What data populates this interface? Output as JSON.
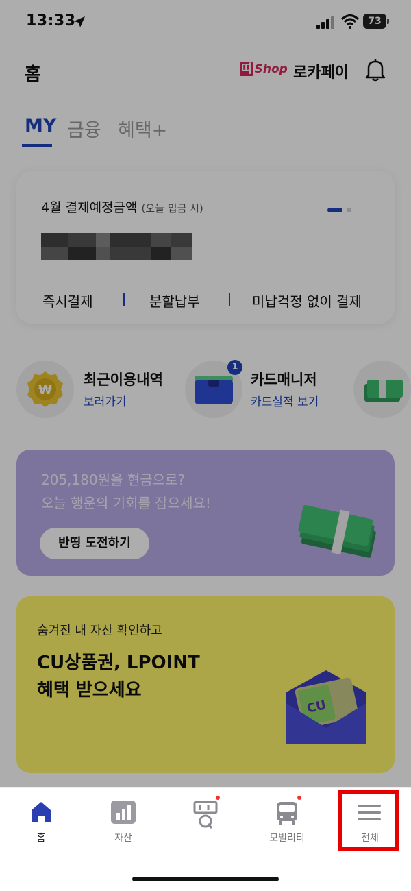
{
  "status_bar": {
    "time": "13:33",
    "battery": "73"
  },
  "header": {
    "title": "홈",
    "shop_logo_mark": "띠",
    "shop_logo_text": "Shop",
    "locapay": "로카페이"
  },
  "tabs": [
    {
      "label": "MY"
    },
    {
      "label": "금융"
    },
    {
      "label": "혜택+"
    }
  ],
  "payment_card": {
    "title": "4월 결제예정금액",
    "subtitle": "(오늘 입금 시)",
    "actions": [
      "즉시결제",
      "분할납부",
      "미납걱정 없이 결제"
    ]
  },
  "shortcuts": [
    {
      "title": "최근이용내역",
      "link": "보러가기",
      "icon": "won-coin-icon"
    },
    {
      "title": "카드매니저",
      "link": "카드실적 보기",
      "icon": "wallet-icon",
      "badge": "1"
    }
  ],
  "banner_cash": {
    "line1": "205,180원을 현금으로?",
    "line2": "오늘 행운의 기회를 잡으세요!",
    "button": "반띵 도전하기",
    "color": "#b7abe6"
  },
  "banner_cu": {
    "subtitle": "숨겨진 내 자산 확인하고",
    "title_line1": "CU상품권, LPOINT",
    "title_line2": "혜택 받으세요",
    "envelope_text": "CU",
    "color": "#fff56a"
  },
  "bottom_nav": [
    {
      "label": "홈",
      "icon": "home-icon"
    },
    {
      "label": "자산",
      "icon": "chart-icon"
    },
    {
      "label": "",
      "icon": "ddi-q-icon"
    },
    {
      "label": "모빌리티",
      "icon": "bus-icon"
    },
    {
      "label": "전체",
      "icon": "menu-icon"
    }
  ],
  "accent_color": "#1f45b8"
}
